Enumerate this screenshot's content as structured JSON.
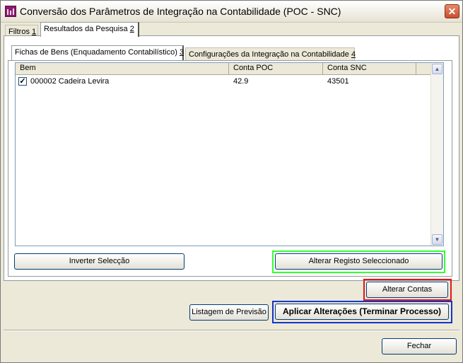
{
  "window": {
    "title": "Conversão dos Parâmetros de Integração na Contabilidade (POC - SNC)",
    "close_label": "✕"
  },
  "outer_tabs": [
    {
      "label": "Filtros",
      "count": "1"
    },
    {
      "label": "Resultados da Pesquisa",
      "count": "2"
    }
  ],
  "inner_tabs": [
    {
      "label": "Fichas de Bens (Enquadamento Contabilístico)",
      "count": "3"
    },
    {
      "label": "Configurações da Integração na Contabilidade",
      "count": "4"
    }
  ],
  "grid": {
    "columns": [
      "Bem",
      "Conta POC",
      "Conta SNC"
    ],
    "rows": [
      {
        "checked": true,
        "bem": "000002 Cadeira Levira",
        "conta_poc": "42.9",
        "conta_snc": "43501"
      }
    ],
    "scroll_up_icon": "▲",
    "scroll_down_icon": "▼"
  },
  "buttons": {
    "invert_label": "Inverter Selecção",
    "alter_record_label": "Alterar Registo Seleccionado",
    "alter_accounts_label": "Alterar Contas",
    "preview_label": "Listagem de Previsão",
    "apply_label": "Aplicar Alterações (Terminar Processo)",
    "close_label": "Fechar"
  },
  "highlight_colors": {
    "alter_record": "#33ff33",
    "alter_accounts": "#e8141b",
    "apply": "#1734c9"
  }
}
